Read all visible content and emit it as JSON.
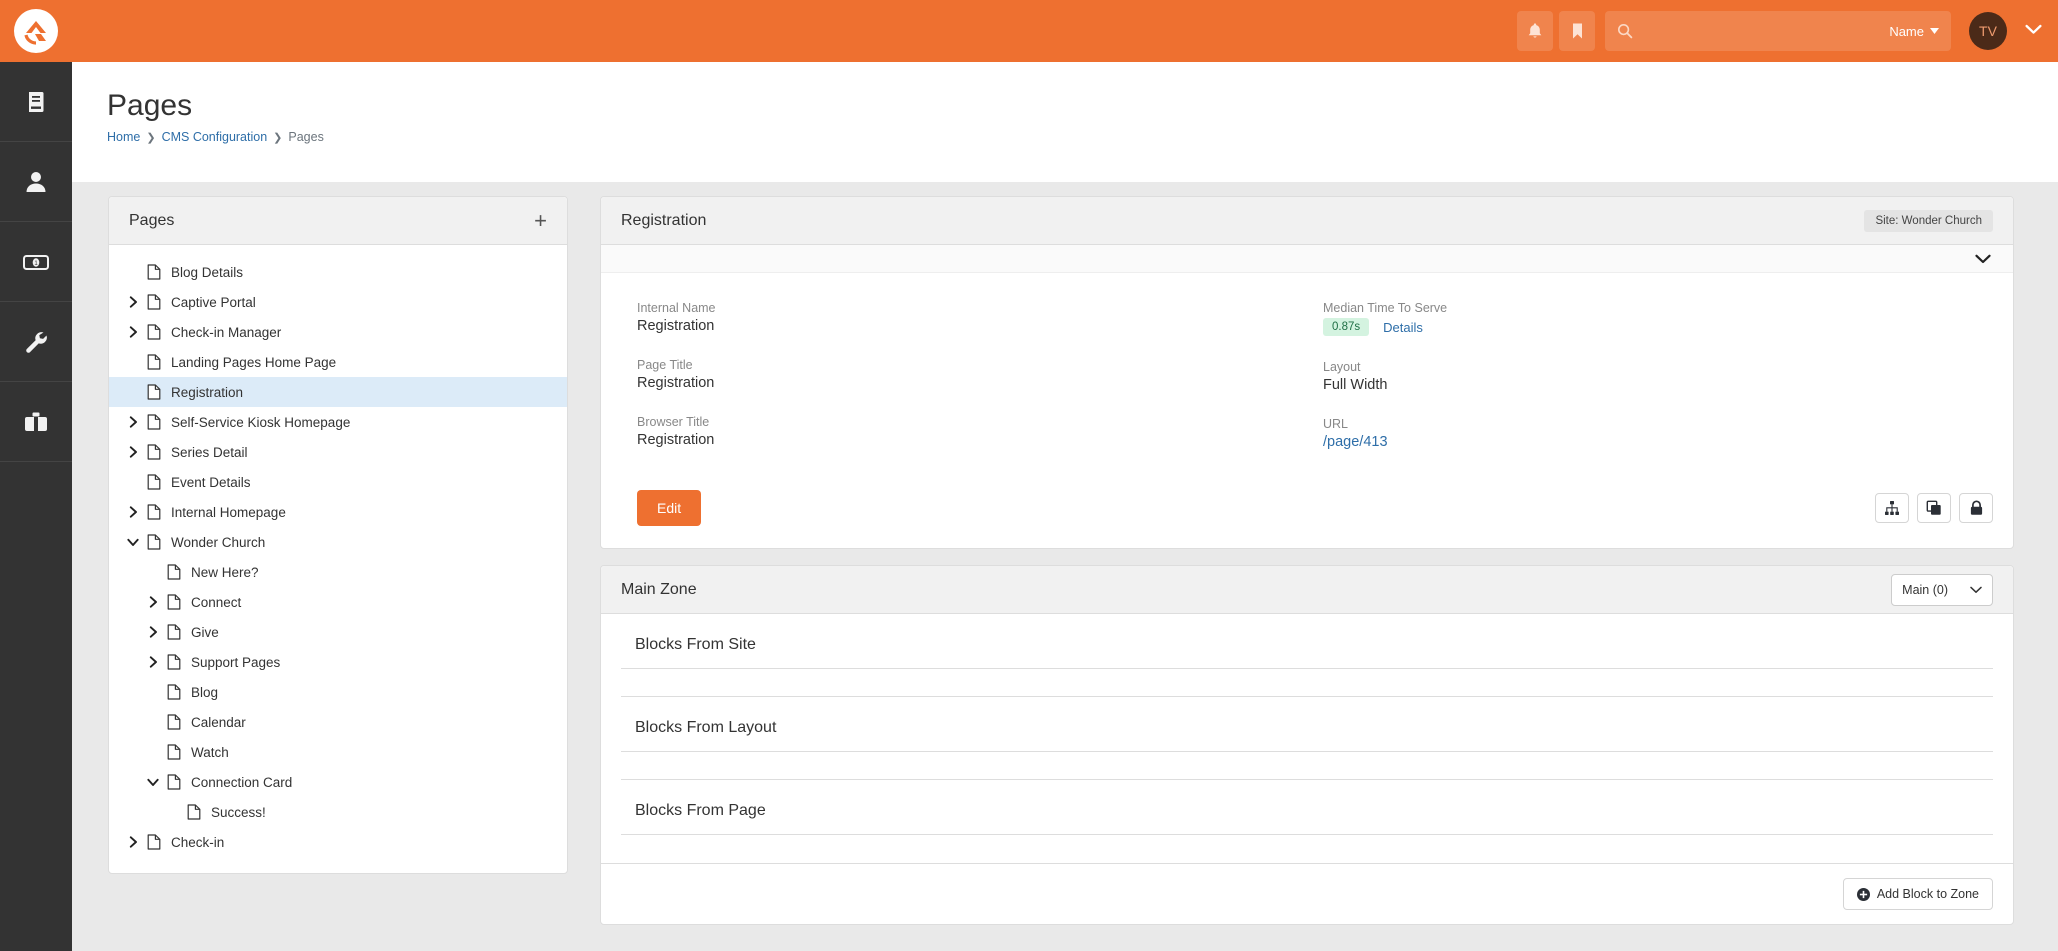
{
  "brand": {
    "accent": "#ee7030",
    "logo_icon": "rock-rms-logo-icon"
  },
  "topbar": {
    "notifications_icon": "bell-icon",
    "bookmarks_icon": "bookmark-icon",
    "search": {
      "icon": "search-icon",
      "value": "",
      "placeholder": "",
      "scope_label": "Name"
    },
    "user": {
      "initials": "TV",
      "caret_icon": "chevron-down-icon"
    }
  },
  "rail": {
    "items": [
      {
        "name": "cms",
        "icon": "book-icon"
      },
      {
        "name": "people",
        "icon": "person-icon"
      },
      {
        "name": "finance",
        "icon": "money-bill-icon"
      },
      {
        "name": "tools",
        "icon": "wrench-icon"
      },
      {
        "name": "admin",
        "icon": "toolbox-icon"
      }
    ]
  },
  "page": {
    "title": "Pages",
    "breadcrumb": [
      {
        "label": "Home",
        "link": true
      },
      {
        "label": "CMS Configuration",
        "link": true
      },
      {
        "label": "Pages",
        "link": false
      }
    ]
  },
  "pages_panel": {
    "title": "Pages",
    "add_icon": "plus-icon",
    "tree": [
      {
        "label": "Blog Details",
        "depth": 0,
        "toggle": "none",
        "selected": false
      },
      {
        "label": "Captive Portal",
        "depth": 0,
        "toggle": "collapsed",
        "selected": false
      },
      {
        "label": "Check-in Manager",
        "depth": 0,
        "toggle": "collapsed",
        "selected": false
      },
      {
        "label": "Landing Pages Home Page",
        "depth": 0,
        "toggle": "none",
        "selected": false
      },
      {
        "label": "Registration",
        "depth": 0,
        "toggle": "none",
        "selected": true
      },
      {
        "label": "Self-Service Kiosk Homepage",
        "depth": 0,
        "toggle": "collapsed",
        "selected": false
      },
      {
        "label": "Series Detail",
        "depth": 0,
        "toggle": "collapsed",
        "selected": false
      },
      {
        "label": "Event Details",
        "depth": 0,
        "toggle": "none",
        "selected": false
      },
      {
        "label": "Internal Homepage",
        "depth": 0,
        "toggle": "collapsed",
        "selected": false
      },
      {
        "label": "Wonder Church",
        "depth": 0,
        "toggle": "expanded",
        "selected": false
      },
      {
        "label": "New Here?",
        "depth": 1,
        "toggle": "none",
        "selected": false
      },
      {
        "label": "Connect",
        "depth": 1,
        "toggle": "collapsed",
        "selected": false
      },
      {
        "label": "Give",
        "depth": 1,
        "toggle": "collapsed",
        "selected": false
      },
      {
        "label": "Support Pages",
        "depth": 1,
        "toggle": "collapsed",
        "selected": false
      },
      {
        "label": "Blog",
        "depth": 1,
        "toggle": "none",
        "selected": false
      },
      {
        "label": "Calendar",
        "depth": 1,
        "toggle": "none",
        "selected": false
      },
      {
        "label": "Watch",
        "depth": 1,
        "toggle": "none",
        "selected": false
      },
      {
        "label": "Connection Card",
        "depth": 1,
        "toggle": "expanded",
        "selected": false
      },
      {
        "label": "Success!",
        "depth": 2,
        "toggle": "none",
        "selected": false
      },
      {
        "label": "Check-in",
        "depth": 0,
        "toggle": "collapsed",
        "selected": false
      }
    ]
  },
  "detail_card": {
    "title": "Registration",
    "site_badge": "Site: Wonder Church",
    "collapse_icon": "chevron-down-icon",
    "left_fields": [
      {
        "label": "Internal Name",
        "value": "Registration",
        "link": false
      },
      {
        "label": "Page Title",
        "value": "Registration",
        "link": false
      },
      {
        "label": "Browser Title",
        "value": "Registration",
        "link": false
      }
    ],
    "performance": {
      "label": "Median Time To Serve",
      "pill": "0.87s",
      "pill_bg": "#d4f3e0",
      "pill_color": "#1f6f45",
      "details_link": "Details"
    },
    "right_fields": [
      {
        "label": "Layout",
        "value": "Full Width",
        "link": false
      },
      {
        "label": "URL",
        "value": "/page/413",
        "link": true
      }
    ],
    "edit_label": "Edit",
    "action_icons": [
      {
        "name": "sitemap-icon"
      },
      {
        "name": "copy-icon"
      },
      {
        "name": "lock-icon"
      }
    ]
  },
  "zone_card": {
    "title": "Main Zone",
    "zone_select": {
      "value": "Main (0)",
      "caret_icon": "chevron-down-icon"
    },
    "sections": [
      {
        "title": "Blocks From Site"
      },
      {
        "title": "Blocks From Layout"
      },
      {
        "title": "Blocks From Page"
      }
    ],
    "add_block_label": "Add Block to Zone",
    "add_block_icon": "plus-circle-icon"
  }
}
